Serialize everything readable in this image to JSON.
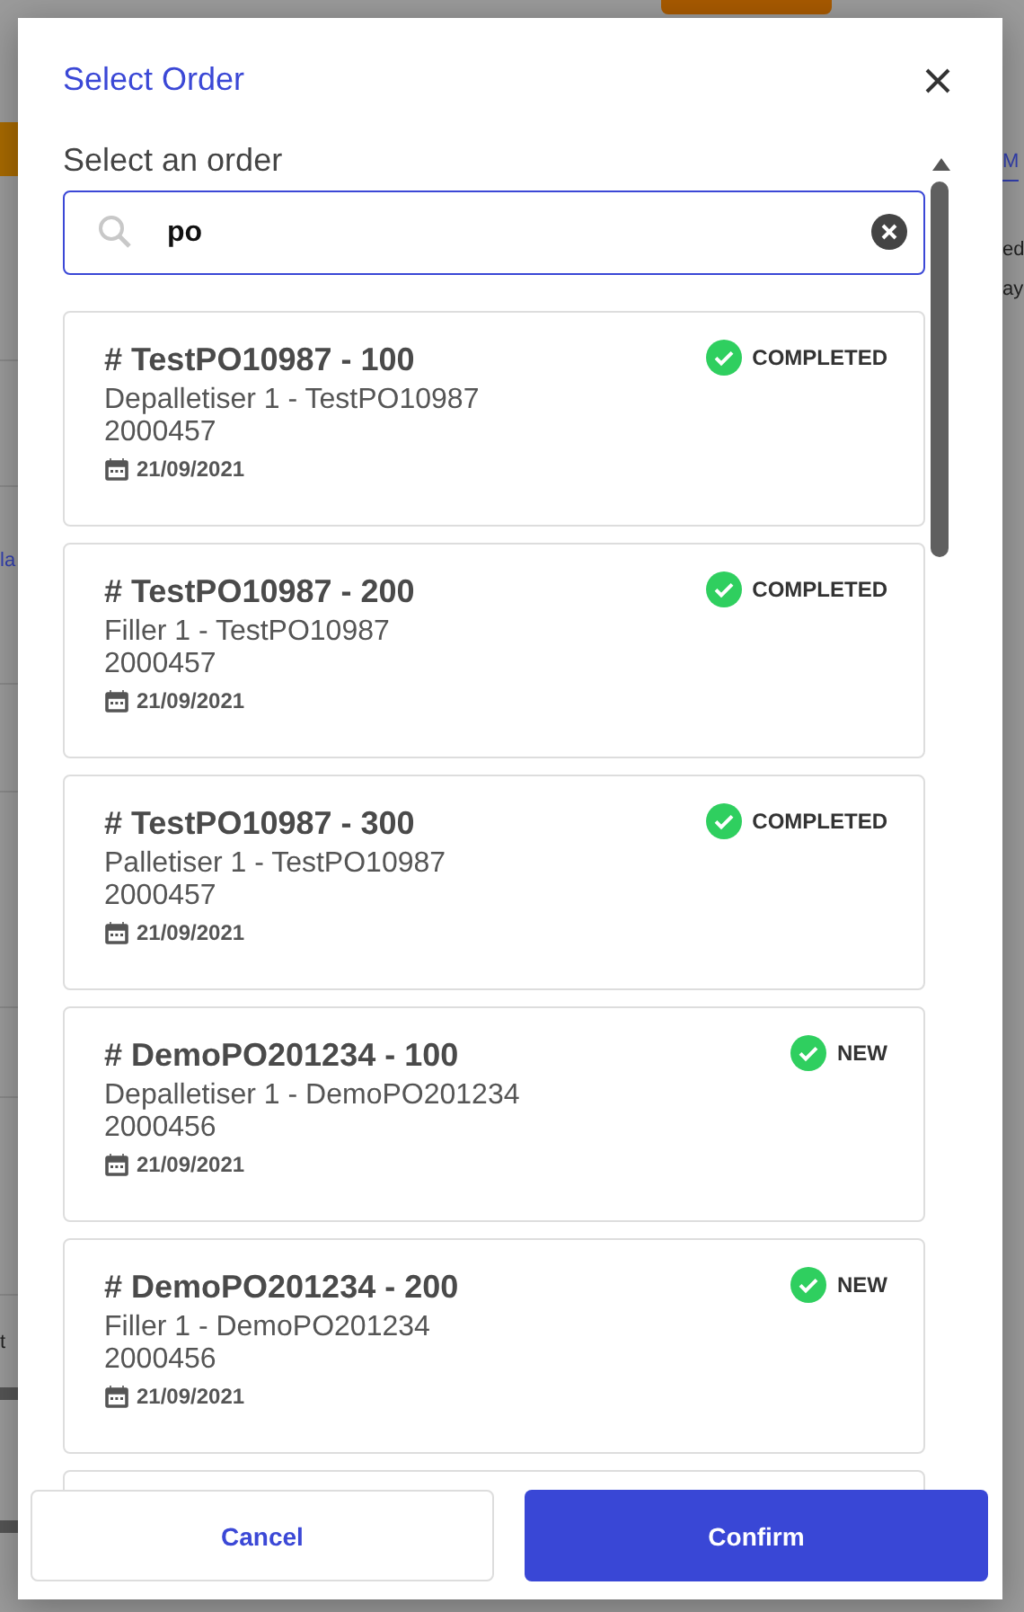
{
  "background": {
    "texts": [
      {
        "text": "M",
        "kind": "tab"
      },
      {
        "text": "ed",
        "kind": "plain"
      },
      {
        "text": "ay",
        "kind": "plain"
      },
      {
        "text": "la",
        "kind": "link"
      },
      {
        "text": "t",
        "kind": "plain"
      }
    ]
  },
  "dialog": {
    "title": "Select Order",
    "label": "Select an order",
    "search": {
      "value": "po"
    },
    "orders": [
      {
        "title": "# TestPO10987 - 100",
        "line": "Depalletiser 1 - TestPO10987",
        "code": "2000457",
        "date": "21/09/2021",
        "status": "COMPLETED"
      },
      {
        "title": "# TestPO10987 - 200",
        "line": "Filler 1 - TestPO10987",
        "code": "2000457",
        "date": "21/09/2021",
        "status": "COMPLETED"
      },
      {
        "title": "# TestPO10987 - 300",
        "line": "Palletiser 1 - TestPO10987",
        "code": "2000457",
        "date": "21/09/2021",
        "status": "COMPLETED"
      },
      {
        "title": "# DemoPO201234 - 100",
        "line": "Depalletiser 1 - DemoPO201234",
        "code": "2000456",
        "date": "21/09/2021",
        "status": "NEW"
      },
      {
        "title": "# DemoPO201234 - 200",
        "line": "Filler 1 - DemoPO201234",
        "code": "2000456",
        "date": "21/09/2021",
        "status": "NEW"
      }
    ],
    "more_below": true,
    "buttons": [
      {
        "label": "Cancel",
        "kind": "secondary"
      },
      {
        "label": "Confirm",
        "kind": "primary"
      }
    ]
  }
}
